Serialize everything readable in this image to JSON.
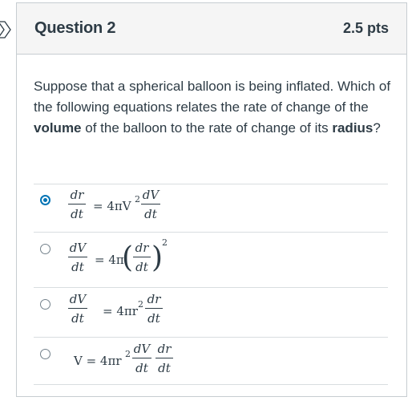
{
  "question": {
    "title": "Question 2",
    "points": "2.5 pts",
    "text_before": "Suppose that a spherical balloon is being inflated.  Which of the following equations relates the rate of change of the ",
    "bold_volume": "volume",
    "text_middle": " of the balloon to the rate of change of its ",
    "bold_radius": "radius",
    "text_after": "?"
  },
  "answers": [
    {
      "selected": true,
      "lhs_num": "dr",
      "lhs_den": "dt",
      "middle": "= 4πV",
      "middle_sup": "2",
      "rhs_num": "dV",
      "rhs_den": "dt"
    },
    {
      "selected": false,
      "lhs_num": "dV",
      "lhs_den": "dt",
      "middle": "= 4π",
      "rhs_num": "dr",
      "rhs_den": "dt",
      "paren_sup": "2"
    },
    {
      "selected": false,
      "lhs_num": "dV",
      "lhs_den": "dt",
      "middle": "= 4πr",
      "middle_sup": "2",
      "rhs_num": "dr",
      "rhs_den": "dt"
    },
    {
      "selected": false,
      "prefix": "V = 4πr",
      "prefix_sup": "2",
      "frac1_num": "dV",
      "frac1_den": "dt",
      "frac2_num": "dr",
      "frac2_den": "dt"
    }
  ],
  "colors": {
    "accent": "#0374b5",
    "text": "#2d3b45",
    "border": "#c7cdd1",
    "header_bg": "#f5f5f5"
  },
  "icons": {
    "marker": "question-arrow-icon"
  }
}
